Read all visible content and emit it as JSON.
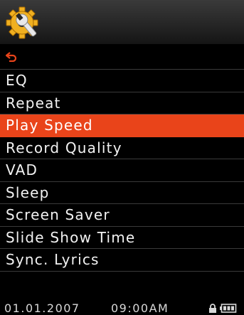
{
  "header": {
    "icon": "settings-gear-wrench-icon",
    "icon_colors": {
      "gear": "#f0b020",
      "wrench": "#e8e8e8"
    }
  },
  "menu": {
    "back_icon": "back-arrow-icon",
    "items": [
      {
        "label": "EQ"
      },
      {
        "label": "Repeat"
      },
      {
        "label": "Play Speed"
      },
      {
        "label": "Record Quality"
      },
      {
        "label": "VAD"
      },
      {
        "label": "Sleep"
      },
      {
        "label": "Screen Saver"
      },
      {
        "label": "Slide Show Time"
      },
      {
        "label": "Sync. Lyrics"
      }
    ],
    "selected_label": "Play Speed",
    "highlight_color": "#e9441a"
  },
  "status": {
    "date": "01.01.2007",
    "time": "09:00AM",
    "icons": [
      "lock-icon",
      "battery-icon"
    ]
  }
}
